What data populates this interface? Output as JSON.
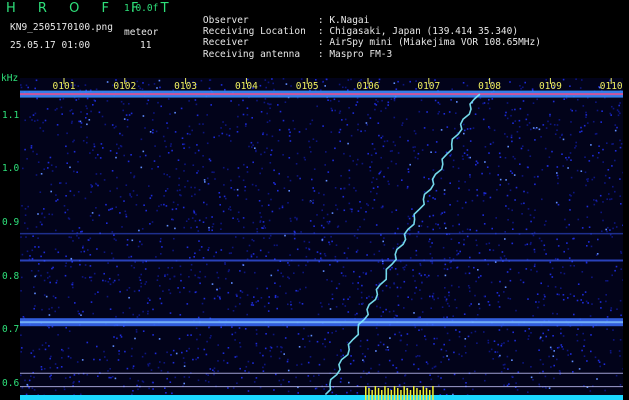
{
  "header": {
    "brand": "H R O F F T",
    "version": "1.0.0f",
    "filename": "KN9_2505170100.png",
    "mode": "meteor",
    "timestamp": "25.05.17 01:00",
    "count": "11"
  },
  "info": [
    {
      "key": "Observer",
      "value": ": K.Nagai"
    },
    {
      "key": "Receiving Location",
      "value": ": Chigasaki, Japan (139.414 35.340)"
    },
    {
      "key": "Receiver",
      "value": ": AirSpy mini (Miakejima VOR 108.65MHz)"
    },
    {
      "key": "Receiving antenna",
      "value": ": Maspro FM-3"
    }
  ],
  "chart_data": {
    "type": "heatmap",
    "ylabel": "kHz",
    "y_ticks": [
      "1.1",
      "1.0",
      "0.9",
      "0.8",
      "0.7",
      "0.6"
    ],
    "x_ticks": [
      "0101",
      "0102",
      "0103",
      "0104",
      "0105",
      "0106",
      "0107",
      "0108",
      "0109",
      "0110"
    ],
    "ylim": [
      0.57,
      1.17
    ],
    "carrier_bands_khz": [
      1.14,
      0.715,
      0.83,
      0.88
    ],
    "meteor_trail": {
      "start": {
        "time": "0105.3",
        "khz": 0.58
      },
      "end": {
        "time": "0107.8",
        "khz": 1.14
      }
    },
    "colors": {
      "background": "#02031a",
      "noise": "#1d2bd8",
      "strong": "#f24b86",
      "trail": "#80f0ff",
      "axis_text": "#2ee07a",
      "hour_labels": "#f0f060"
    }
  }
}
